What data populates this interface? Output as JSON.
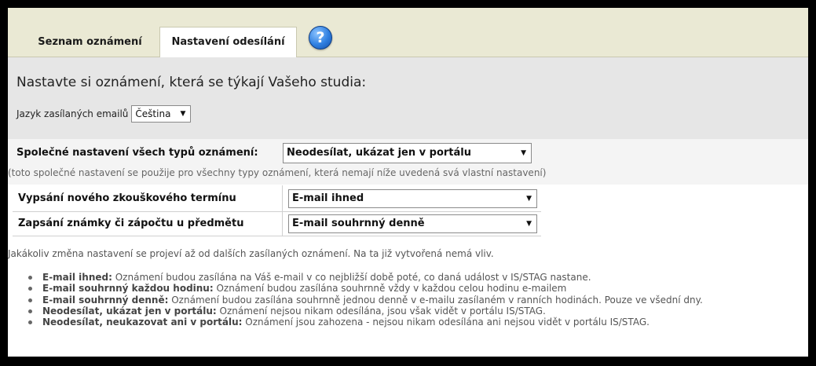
{
  "tabs": [
    {
      "label": "Seznam oznámení"
    },
    {
      "label": "Nastavení odesílání"
    }
  ],
  "help_icon": "question-mark-icon",
  "intro": {
    "title": "Nastavte si oznámení, která se týkají Vašeho studia:",
    "language_label": "Jazyk zasílaných emailů",
    "language_value": "Čeština"
  },
  "common": {
    "label": "Společné nastavení všech typů oznámení:",
    "value": "Neodesílat, ukázat jen v portálu",
    "note": "(toto společné nastavení se použije pro všechny typy oznámení, která nemají níže uvedená svá vlastní nastavení)"
  },
  "rows": [
    {
      "label": "Vypsání nového zkouškového termínu",
      "value": "E-mail ihned"
    },
    {
      "label": "Zapsání známky či zápočtu u předmětu",
      "value": "E-mail souhrnný denně"
    }
  ],
  "note": "Jakákoliv změna nastavení se projeví až od dalších zasílaných oznámení. Na ta již vytvořená nemá vliv.",
  "legend": [
    {
      "term": "E-mail ihned:",
      "desc": " Oznámení budou zasílána na Váš e-mail v co nejbližší době poté, co daná událost v IS/STAG nastane."
    },
    {
      "term": "E-mail souhrnný každou hodinu:",
      "desc": " Oznámení budou zasílána souhrnně vždy v každou celou hodinu e-mailem"
    },
    {
      "term": "E-mail souhrnný denně:",
      "desc": " Oznámení budou zasílána souhrnně jednou denně v e-mailu zasílaném v ranních hodinách. Pouze ve všední dny."
    },
    {
      "term": "Neodesílat, ukázat jen v portálu:",
      "desc": " Oznámení nejsou nikam odesílána, jsou však vidět v portálu IS/STAG."
    },
    {
      "term": "Neodesílat, neukazovat ani v portálu:",
      "desc": " Oznámení jsou zahozena - nejsou nikam odesílána ani nejsou vidět v portálu IS/STAG."
    }
  ]
}
